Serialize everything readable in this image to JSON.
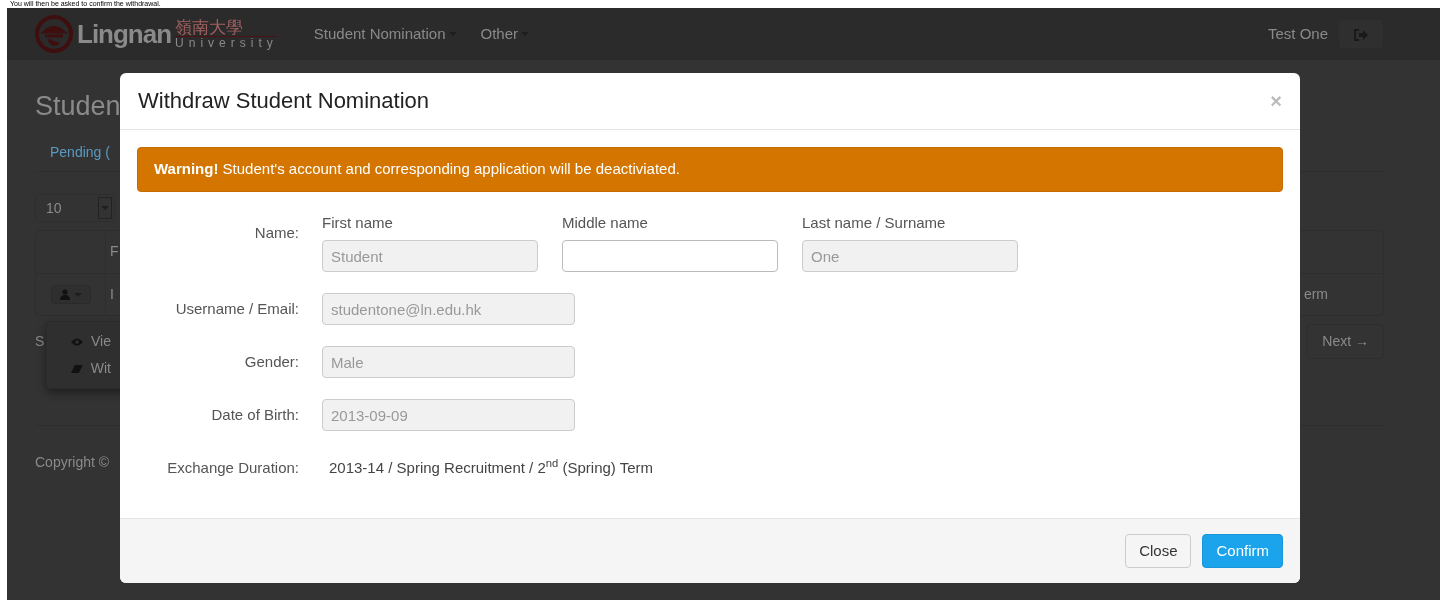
{
  "caption": "You will then be asked to confirm the withdrawal.",
  "navbar": {
    "brand": {
      "latin": "Lingnan",
      "chinese": "嶺南大學",
      "subtitle": "University"
    },
    "menus": [
      {
        "label": "Student Nomination"
      },
      {
        "label": "Other"
      }
    ],
    "user": "Test One"
  },
  "page": {
    "heading": "Studen",
    "tabs": [
      {
        "label": "Pending (",
        "selected": true
      }
    ],
    "page_size": "10",
    "table": {
      "header": "F",
      "cell": "I",
      "cell_right": "erm"
    },
    "row_menu": [
      {
        "label": "Vie",
        "kind": "view"
      },
      {
        "label": "Wit",
        "kind": "withdraw"
      }
    ],
    "summary": "S",
    "next": "Next →",
    "footer": "Copyright ©"
  },
  "modal": {
    "title": "Withdraw Student Nomination",
    "close": "×",
    "alert": "**Warning!** Student's account and corresponding application will be deactiviated.",
    "name_label": "Name:",
    "name_parts": [
      {
        "label": "First name",
        "value": "Student",
        "disabled": true
      },
      {
        "label": "Middle name",
        "disabled": false
      },
      {
        "label": "Last name / Surname",
        "value": "One",
        "disabled": true
      }
    ],
    "rows": [
      {
        "label": "Username / Email:",
        "kind": "input",
        "value": "studentone@ln.edu.hk",
        "disabled": true
      },
      {
        "label": "Gender:",
        "kind": "input",
        "value": "Male",
        "disabled": true
      },
      {
        "label": "Date of Birth:",
        "kind": "input",
        "value": "2013-09-09",
        "disabled": true
      },
      {
        "label": "Exchange Duration:",
        "kind": "static",
        "value": "2013-14 / Spring Recruitment / 2$^{nd}$ (Spring) Term"
      }
    ],
    "buttons": [
      {
        "label": "Close",
        "kind": "default"
      },
      {
        "label": "Confirm",
        "kind": "primary"
      }
    ]
  }
}
